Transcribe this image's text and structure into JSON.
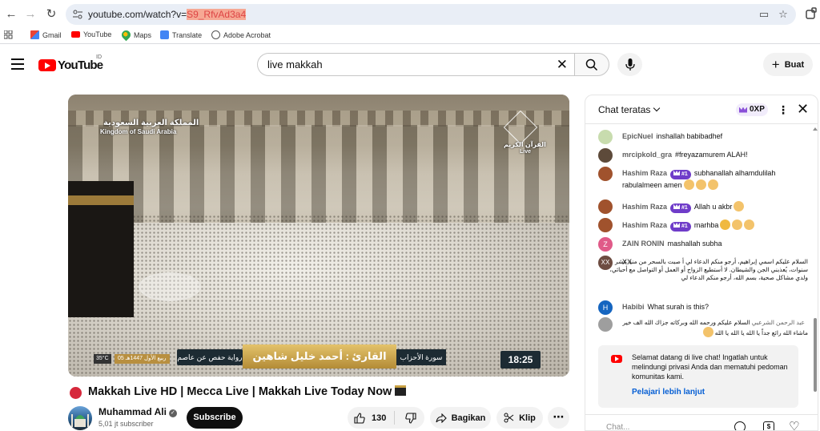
{
  "browser": {
    "url_prefix": "youtube.com/watch?v=",
    "url_highlight": "S9_RfvAd3a4",
    "bookmarks": [
      "Gmail",
      "YouTube",
      "Maps",
      "Translate",
      "Adobe Acrobat"
    ]
  },
  "header": {
    "logo_text": "YouTube",
    "country": "ID",
    "search_value": "live makkah",
    "create_label": "Buat"
  },
  "video": {
    "overlay_ar": "المملكة العربية السعودية",
    "overlay_en": "Kingdom of Saudi Arabia",
    "channel_logo_ar": "القرآن الكريم",
    "channel_logo_live": "Live",
    "temp": "35°C",
    "date_ar": "05 ربيع الأول 1447هـ",
    "riwayah": "رواية حفص عن عاصم",
    "qari": "القارئ : أحمد خليل شاهين",
    "surah": "سورة الأحزاب",
    "time": "18:25",
    "title": "Makkah Live HD | Mecca Live | Makkah Live Today Now",
    "channel_name": "Muhammad Ali",
    "subscribers": "5,01 jt subscriber",
    "subscribe_label": "Subscribe",
    "likes": "130",
    "share_label": "Bagikan",
    "clip_label": "Klip"
  },
  "chat": {
    "title": "Chat teratas",
    "xp": "0XP",
    "messages": [
      {
        "author": "EpicNuel",
        "badge": "",
        "text": "inshallah babibadhef",
        "color": "#8bc34a"
      },
      {
        "author": "mrcipkold_gra",
        "badge": "",
        "text": "#freyazamurem  ALAH!",
        "color": "#5d4a3a"
      },
      {
        "author": "Hashim Raza",
        "badge": "#1",
        "text": "subhanallah alhamdulilah rabulalmeen amen",
        "color": "#a0522d"
      },
      {
        "author": "Hashim Raza",
        "badge": "#1",
        "text": "Allah u akbr",
        "color": "#a0522d"
      },
      {
        "author": "Hashim Raza",
        "badge": "#1",
        "text": "marhba",
        "color": "#a0522d"
      },
      {
        "author": "ZAIN RONIN",
        "badge": "",
        "text": "mashallah subha",
        "color": "#e05a88"
      },
      {
        "author": "XX",
        "badge": "",
        "text": "السلام عليكم اسمي إبراهيم، أرجو منكم الدعاء لي أ صبت بالسحر من منذ عشر سنوات، يُعذبني الجن والشيطان. لا أستطيع الزواج أو العمل أو التواصل مع أحبائي، ولدي مشاكل صحية، بسم الله، أرجو منكم الدعاء لي",
        "color": "#6d4c41"
      },
      {
        "author": "Habibi",
        "badge": "",
        "text": "What surah is this?",
        "color": "#1565c0"
      },
      {
        "author": "عبد الرحمن الشرعبي",
        "badge": "",
        "text": "السلام عليكم ورحمه الله وبركاته جزاك الله الف خير ماشاء الله رائع جداً يا الله يا الله يا الله",
        "color": "#9e9e9e"
      }
    ],
    "welcome_text": "Selamat datang di live chat! Ingatlah untuk melindungi privasi Anda dan mematuhi pedoman komunitas kami.",
    "welcome_link": "Pelajari lebih lanjut",
    "input_placeholder": "Chat..."
  }
}
